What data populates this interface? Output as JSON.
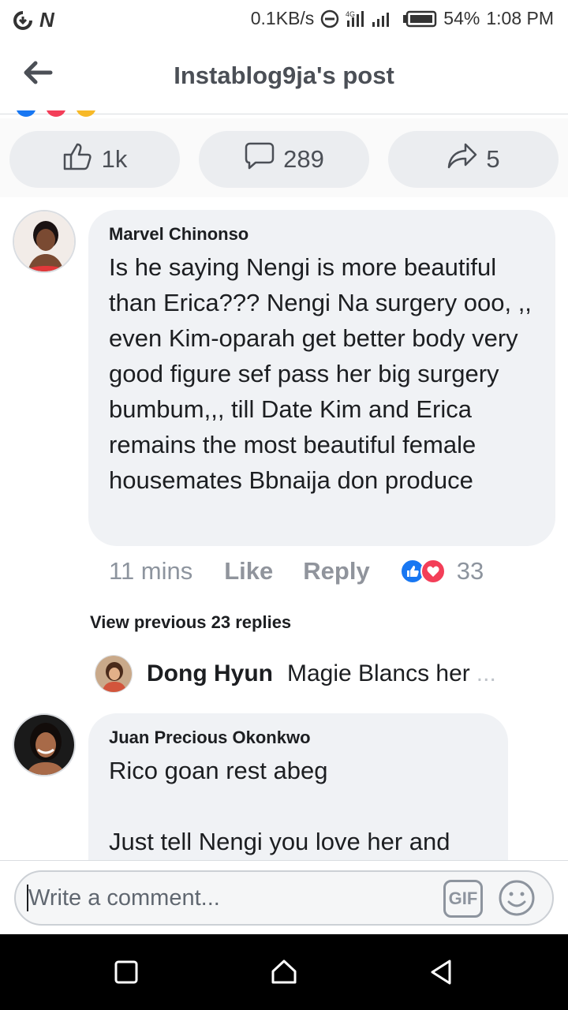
{
  "status_bar": {
    "net_speed": "0.1KB/s",
    "battery": "54%",
    "time": "1:08 PM",
    "app_icon": "N"
  },
  "header": {
    "title": "Instablog9ja's post"
  },
  "actions": {
    "likes": "1k",
    "comments": "289",
    "shares": "5"
  },
  "comment1": {
    "author": "Marvel Chinonso",
    "text": "Is he saying Nengi is more beautiful than Erica??? Nengi Na surgery ooo, ,, even Kim-oparah get better body very good figure sef pass her big surgery bumbum,,, till Date Kim and Erica remains the most beautiful female housemates Bbnaija don produce",
    "time": "11 mins",
    "like_label": "Like",
    "reply_label": "Reply",
    "reaction_count": "33"
  },
  "replies": {
    "view_previous": "View previous 23 replies",
    "latest_author": "Dong Hyun",
    "latest_text": "Magie Blancs  her",
    "ellipsis": "..."
  },
  "comment2": {
    "author": "Juan Precious Okonkwo",
    "text": "Rico goan rest abeg\n\nJust tell Nengi you love her and"
  },
  "composer": {
    "placeholder": "Write a comment...",
    "gif_label": "GIF"
  },
  "colors": {
    "like_blue": "#1877f2",
    "love_red": "#f33e58",
    "bubble_bg": "#f0f2f5",
    "muted": "#8d949e"
  }
}
